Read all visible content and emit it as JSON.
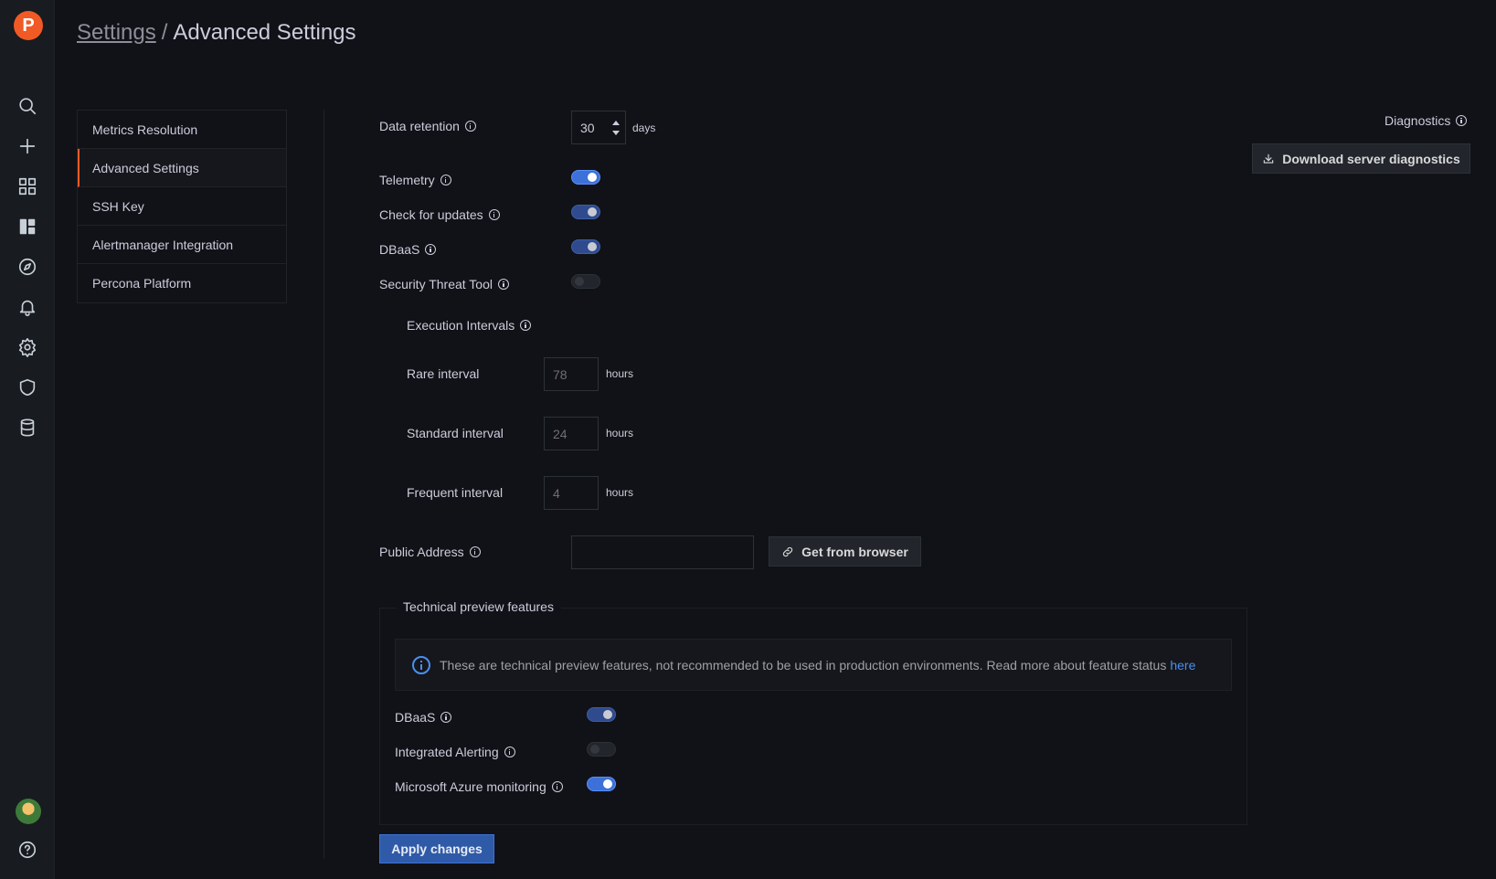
{
  "breadcrumb": {
    "parent": "Settings",
    "separator": "/",
    "current": "Advanced Settings"
  },
  "sidebar_nav": [
    "percona-logo",
    "search-icon",
    "plus-icon",
    "dashboards-icon",
    "panel-icon",
    "explore-icon",
    "alert-bell-icon",
    "gear-icon",
    "shield-icon",
    "database-icon",
    "avatar",
    "help-icon"
  ],
  "settings_menu": {
    "items": [
      {
        "label": "Metrics Resolution",
        "active": false
      },
      {
        "label": "Advanced Settings",
        "active": true
      },
      {
        "label": "SSH Key",
        "active": false
      },
      {
        "label": "Alertmanager Integration",
        "active": false
      },
      {
        "label": "Percona Platform",
        "active": false
      }
    ]
  },
  "form": {
    "data_retention": {
      "label": "Data retention",
      "value": "30",
      "unit": "days"
    },
    "telemetry": {
      "label": "Telemetry",
      "on": true
    },
    "check_updates": {
      "label": "Check for updates",
      "on": true
    },
    "dbaas": {
      "label": "DBaaS",
      "on": true
    },
    "stt": {
      "label": "Security Threat Tool",
      "on": false
    },
    "execution_intervals": {
      "label": "Execution Intervals",
      "rare": {
        "label": "Rare interval",
        "value": "78",
        "unit": "hours"
      },
      "standard": {
        "label": "Standard interval",
        "value": "24",
        "unit": "hours"
      },
      "frequent": {
        "label": "Frequent interval",
        "value": "4",
        "unit": "hours"
      }
    },
    "public_address": {
      "label": "Public Address",
      "value": "",
      "button": "Get from browser"
    }
  },
  "diagnostics": {
    "label": "Diagnostics",
    "button": "Download server diagnostics"
  },
  "tech_preview": {
    "legend": "Technical preview features",
    "alert_text": "These are technical preview features, not recommended to be used in production environments. Read more about feature status",
    "alert_link": "here",
    "dbaas": {
      "label": "DBaaS",
      "on": true
    },
    "integrated_alerting": {
      "label": "Integrated Alerting",
      "on": false
    },
    "azure": {
      "label": "Microsoft Azure monitoring",
      "on": true
    }
  },
  "apply_button": "Apply changes",
  "colors": {
    "accent": "#f15a24",
    "primary": "#3d71d9",
    "background": "#111217"
  }
}
